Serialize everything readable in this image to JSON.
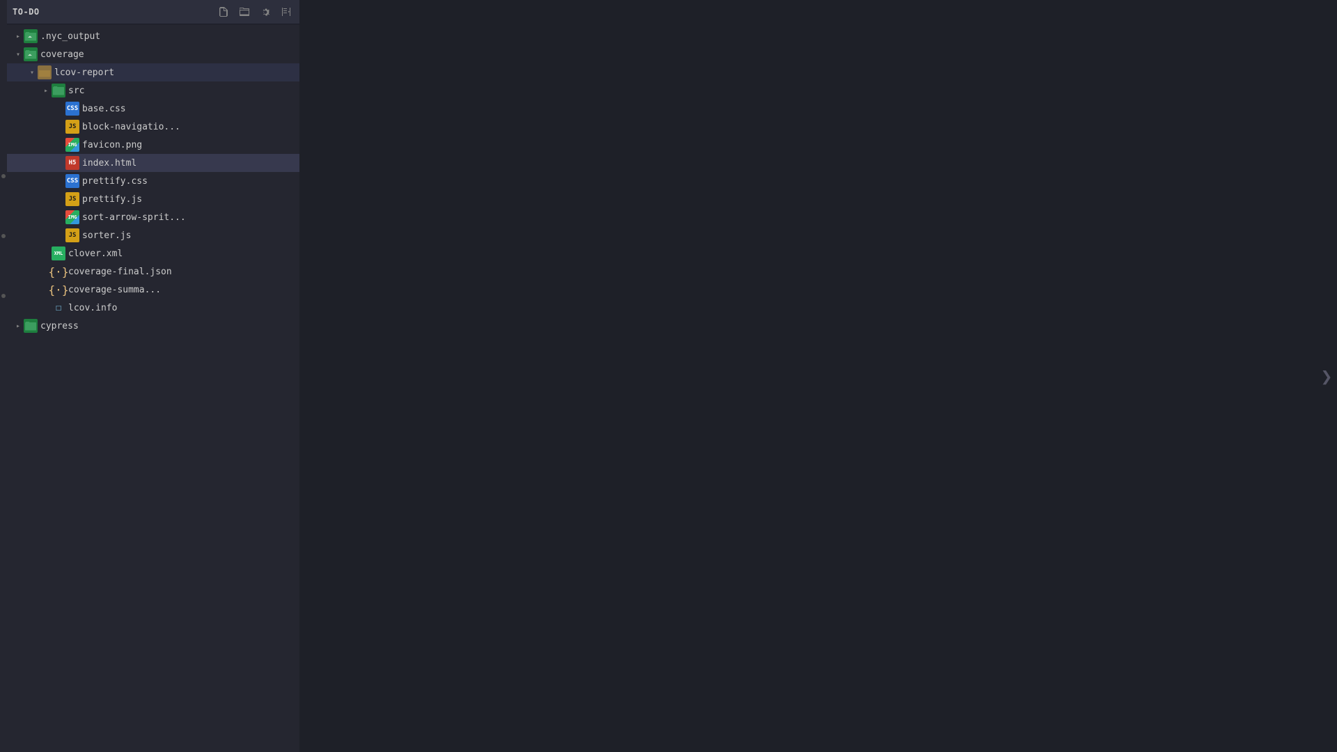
{
  "sidebar": {
    "title": "TO-DO",
    "tree": [
      {
        "id": "nyc_output",
        "label": ".nyc_output",
        "type": "folder",
        "iconType": "folder-green",
        "indent": 0,
        "state": "closed",
        "children": []
      },
      {
        "id": "coverage",
        "label": "coverage",
        "type": "folder",
        "iconType": "folder-green",
        "indent": 0,
        "state": "open",
        "children": [
          {
            "id": "lcov-report",
            "label": "lcov-report",
            "type": "folder",
            "iconType": "folder-default",
            "indent": 1,
            "state": "open",
            "active": true,
            "children": [
              {
                "id": "src",
                "label": "src",
                "type": "folder",
                "iconType": "folder-green",
                "indent": 2,
                "state": "closed",
                "children": []
              },
              {
                "id": "base.css",
                "label": "base.css",
                "type": "file",
                "iconType": "css",
                "iconLabel": "CSS",
                "indent": 3
              },
              {
                "id": "block-navigation",
                "label": "block-navigatio...",
                "type": "file",
                "iconType": "js",
                "iconLabel": "JS",
                "indent": 3
              },
              {
                "id": "favicon.png",
                "label": "favicon.png",
                "type": "file",
                "iconType": "png",
                "iconLabel": "PNG",
                "indent": 3
              },
              {
                "id": "index.html",
                "label": "index.html",
                "type": "file",
                "iconType": "html",
                "iconLabel": "HTML",
                "indent": 3,
                "selected": true
              },
              {
                "id": "prettify.css",
                "label": "prettify.css",
                "type": "file",
                "iconType": "css",
                "iconLabel": "CSS",
                "indent": 3
              },
              {
                "id": "prettify.js",
                "label": "prettify.js",
                "type": "file",
                "iconType": "js",
                "iconLabel": "JS",
                "indent": 3
              },
              {
                "id": "sort-arrow-sprit",
                "label": "sort-arrow-sprit...",
                "type": "file",
                "iconType": "png",
                "iconLabel": "PNG",
                "indent": 3
              },
              {
                "id": "sorter.js",
                "label": "sorter.js",
                "type": "file",
                "iconType": "js",
                "iconLabel": "JS",
                "indent": 3
              }
            ]
          },
          {
            "id": "clover.xml",
            "label": "clover.xml",
            "type": "file",
            "iconType": "xml",
            "iconLabel": "XML",
            "indent": 2
          },
          {
            "id": "coverage-final.json",
            "label": "coverage-final.json",
            "type": "file",
            "iconType": "json",
            "iconLabel": "{·}",
            "indent": 2
          },
          {
            "id": "coverage-summa",
            "label": "coverage-summa...",
            "type": "file",
            "iconType": "json",
            "iconLabel": "{·}",
            "indent": 2
          },
          {
            "id": "lcov.info",
            "label": "lcov.info",
            "type": "file",
            "iconType": "info",
            "iconLabel": "□",
            "indent": 2
          }
        ]
      },
      {
        "id": "cypress",
        "label": "cypress",
        "type": "folder",
        "iconType": "folder-green",
        "indent": 0,
        "state": "closed",
        "children": []
      }
    ]
  },
  "toolbar_icons": {
    "new_file": "⊞",
    "new_folder": "⊟",
    "refresh": "↺",
    "collapse": "⊟"
  },
  "right_chevron": "❯",
  "left_indicators": [
    "•",
    "•",
    "•"
  ]
}
